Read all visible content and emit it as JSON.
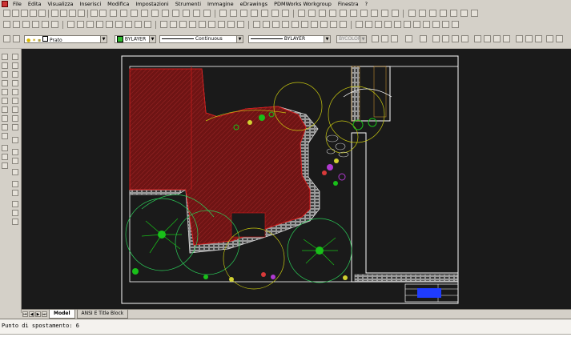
{
  "menu": {
    "items": [
      "File",
      "Edita",
      "Visualizza",
      "Inserisci",
      "Modifica",
      "Impostazioni",
      "Strumenti",
      "Immagine",
      "eDrawings",
      "PDMWorks Workgroup",
      "Finestra",
      "?"
    ]
  },
  "layers": {
    "current_layer": "Prato",
    "color": "BYLAYER",
    "linetype": "Continuous",
    "lineweight": "BYLAYER",
    "plotstyle": "BYCOLOR"
  },
  "tabs": [
    {
      "label": "Model",
      "active": true
    },
    {
      "label": "ANSI E Title Block",
      "active": false
    }
  ],
  "command": {
    "prompt": "Punto di spostamento: 6"
  },
  "colors": {
    "canvas_bg": "#1a1a1a",
    "hatch": "#7a1616",
    "paving": "#c8c8c8",
    "vegetation": "#19c019",
    "border": "#ffffff",
    "accent_title": "#1f3cff",
    "layer_green": "#2eb82e"
  }
}
